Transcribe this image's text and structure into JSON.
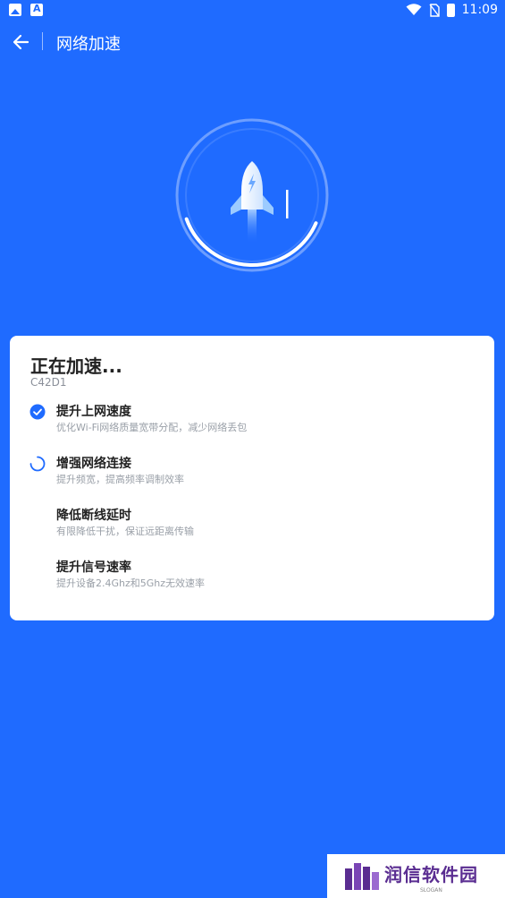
{
  "status_bar": {
    "time": "11:09",
    "icons": [
      "image-icon",
      "a-icon",
      "wifi-icon",
      "no-sim-icon",
      "battery-icon"
    ]
  },
  "app_bar": {
    "title": "网络加速",
    "back_icon": "arrow-left-icon"
  },
  "gauge": {
    "progress": 0.62,
    "icon": "rocket-icon"
  },
  "card": {
    "title": "正在加速...",
    "subtitle": "C42D1",
    "steps": [
      {
        "title": "提升上网速度",
        "desc": "优化Wi-Fi网络质量宽带分配，减少网络丢包",
        "state": "done"
      },
      {
        "title": "增强网络连接",
        "desc": "提升频宽，提高频率调制效率",
        "state": "loading"
      },
      {
        "title": "降低断线延时",
        "desc": "有限降低干扰，保证远距离传输",
        "state": "pending"
      },
      {
        "title": "提升信号速率",
        "desc": "提升设备2.4Ghz和5Ghz无效速率",
        "state": "pending"
      }
    ]
  },
  "watermark": {
    "brand": "润信软件园",
    "slogan": "SLOGAN"
  },
  "colors": {
    "background": "#1f6bff",
    "accent": "#1f6bff",
    "card": "#ffffff"
  }
}
